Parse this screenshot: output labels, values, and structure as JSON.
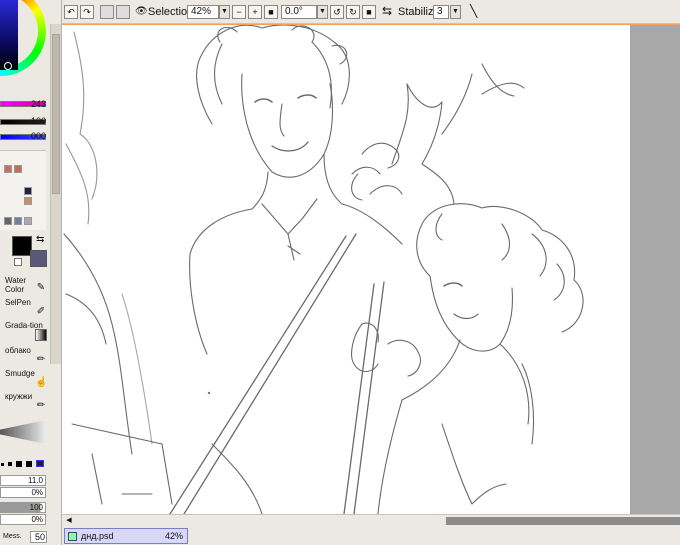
{
  "toolbar": {
    "selection_label": "Selection",
    "zoom_value": "42%",
    "rotation_value": "0.0°",
    "stabilizer_label": "Stabilizer",
    "stabilizer_value": "3",
    "icons": [
      "undo-icon",
      "redo-icon",
      "view-icon",
      "zoom-out-icon",
      "zoom-in-icon",
      "zoom-reset-icon",
      "rotate-left-icon",
      "rotate-right-icon",
      "rotate-reset-icon",
      "flip-icon",
      "stabilizer-line-icon"
    ]
  },
  "color_panel": {
    "hue_value": "243",
    "saturation_value": "100",
    "value_value": "000",
    "foreground_color": "#000000",
    "background_color": "#5a5878"
  },
  "tools": [
    {
      "label": "Water Color",
      "icon": "brush-icon"
    },
    {
      "label": "SelPen",
      "icon": "selection-pen-icon"
    },
    {
      "label": "Grada-tion",
      "icon": "gradient-icon"
    },
    {
      "label": "облако",
      "icon": "pencil-icon"
    },
    {
      "label": "Smudge",
      "icon": "smudge-icon"
    },
    {
      "label": "кружжи",
      "icon": "pencil-icon"
    }
  ],
  "brush_params": {
    "size": "11.0",
    "param_2": "0%",
    "param_3": "0%",
    "param_4": "100",
    "mess_label": "Mess.",
    "mess_value": "50"
  },
  "document_tab": {
    "name": "днд.psd",
    "zoom": "42%"
  }
}
